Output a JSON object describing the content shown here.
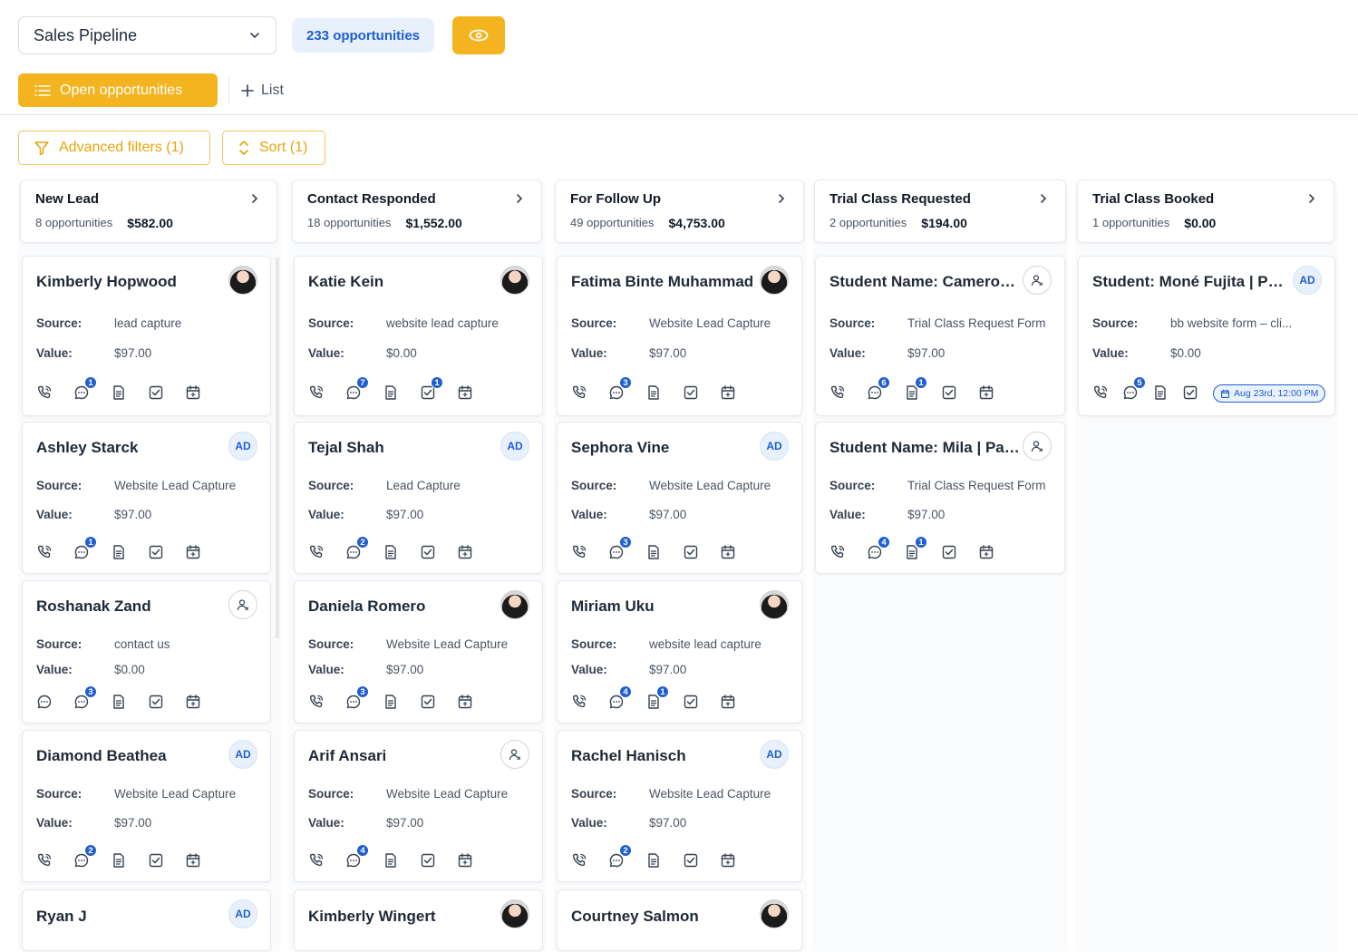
{
  "header": {
    "pipeline_select": "Sales Pipeline",
    "opportunity_count": "233 opportunities",
    "view_icon": "eye-icon"
  },
  "tabs": {
    "open": "Open opportunities",
    "add_list": "List"
  },
  "filters": {
    "advanced": "Advanced filters (1)",
    "sort": "Sort (1)"
  },
  "colors": {
    "accent": "#f3b41f",
    "primary_blue": "#1f5fcf",
    "badge_bg": "#e7f0fb"
  },
  "labels": {
    "source": "Source:",
    "value": "Value:"
  },
  "columns": [
    {
      "title": "New Lead",
      "count": "8 opportunities",
      "amount": "$582.00",
      "cards": [
        {
          "name": "Kimberly Hopwood",
          "avatar": "photo",
          "source": "lead capture",
          "value": "$97.00",
          "badges": {
            "msg": "1"
          }
        },
        {
          "name": "Ashley Starck",
          "avatar": "AD",
          "source": "Website Lead Capture",
          "value": "$97.00",
          "badges": {
            "msg": "1"
          }
        },
        {
          "name": "Roshanak Zand",
          "avatar": "assign",
          "source": "contact us",
          "value": "$0.00",
          "badges": {
            "msg2": "3"
          }
        },
        {
          "name": "Diamond Beathea",
          "avatar": "AD",
          "source": "Website Lead Capture",
          "value": "$97.00",
          "badges": {
            "msg": "2"
          }
        },
        {
          "name": "Ryan J",
          "avatar": "AD"
        }
      ]
    },
    {
      "title": "Contact Responded",
      "count": "18 opportunities",
      "amount": "$1,552.00",
      "cards": [
        {
          "name": "Katie Kein",
          "avatar": "photo",
          "source": "website lead capture",
          "value": "$0.00",
          "badges": {
            "msg": "7",
            "task": "1"
          }
        },
        {
          "name": "Tejal Shah",
          "avatar": "AD",
          "source": "Lead Capture",
          "value": "$97.00",
          "badges": {
            "msg": "2"
          }
        },
        {
          "name": "Daniela Romero",
          "avatar": "photo",
          "source": "Website Lead Capture",
          "value": "$97.00",
          "badges": {
            "msg": "3"
          }
        },
        {
          "name": "Arif Ansari",
          "avatar": "assign",
          "source": "Website Lead Capture",
          "value": "$97.00",
          "badges": {
            "msg": "4"
          }
        },
        {
          "name": "Kimberly Wingert",
          "avatar": "photo"
        }
      ]
    },
    {
      "title": "For Follow Up",
      "count": "49 opportunities",
      "amount": "$4,753.00",
      "cards": [
        {
          "name": "Fatima Binte Muhammad",
          "avatar": "photo",
          "source": "Website Lead Capture",
          "value": "$97.00",
          "badges": {
            "msg": "3"
          }
        },
        {
          "name": "Sephora Vine",
          "avatar": "AD",
          "source": "Website Lead Capture",
          "value": "$97.00",
          "badges": {
            "msg": "3"
          }
        },
        {
          "name": "Miriam Uku",
          "avatar": "photo",
          "source": "website lead capture",
          "value": "$97.00",
          "badges": {
            "msg": "4",
            "doc": "1"
          }
        },
        {
          "name": "Rachel Hanisch",
          "avatar": "AD",
          "source": "Website Lead Capture",
          "value": "$97.00",
          "badges": {
            "msg": "2"
          }
        },
        {
          "name": "Courtney Salmon",
          "avatar": "photo"
        }
      ]
    },
    {
      "title": "Trial Class Requested",
      "count": "2 opportunities",
      "amount": "$194.00",
      "cards": [
        {
          "name": "Student Name: Cameron J...",
          "avatar": "assign",
          "source": "Trial Class Request Form",
          "value": "$97.00",
          "badges": {
            "msg": "6",
            "doc": "1"
          }
        },
        {
          "name": "Student Name: Mila | Pare...",
          "avatar": "assign",
          "source": "Trial Class Request Form",
          "value": "$97.00",
          "badges": {
            "msg": "4",
            "doc": "1"
          }
        }
      ]
    },
    {
      "title": "Trial Class Booked",
      "count": "1 opportunities",
      "amount": "$0.00",
      "cards": [
        {
          "name": "Student: Moné Fujita | Par...",
          "avatar": "AD",
          "source": "bb website form – cli...",
          "value": "$0.00",
          "badges": {
            "msg": "5"
          },
          "appointment": "Aug 23rd, 12:00 PM"
        }
      ]
    }
  ]
}
